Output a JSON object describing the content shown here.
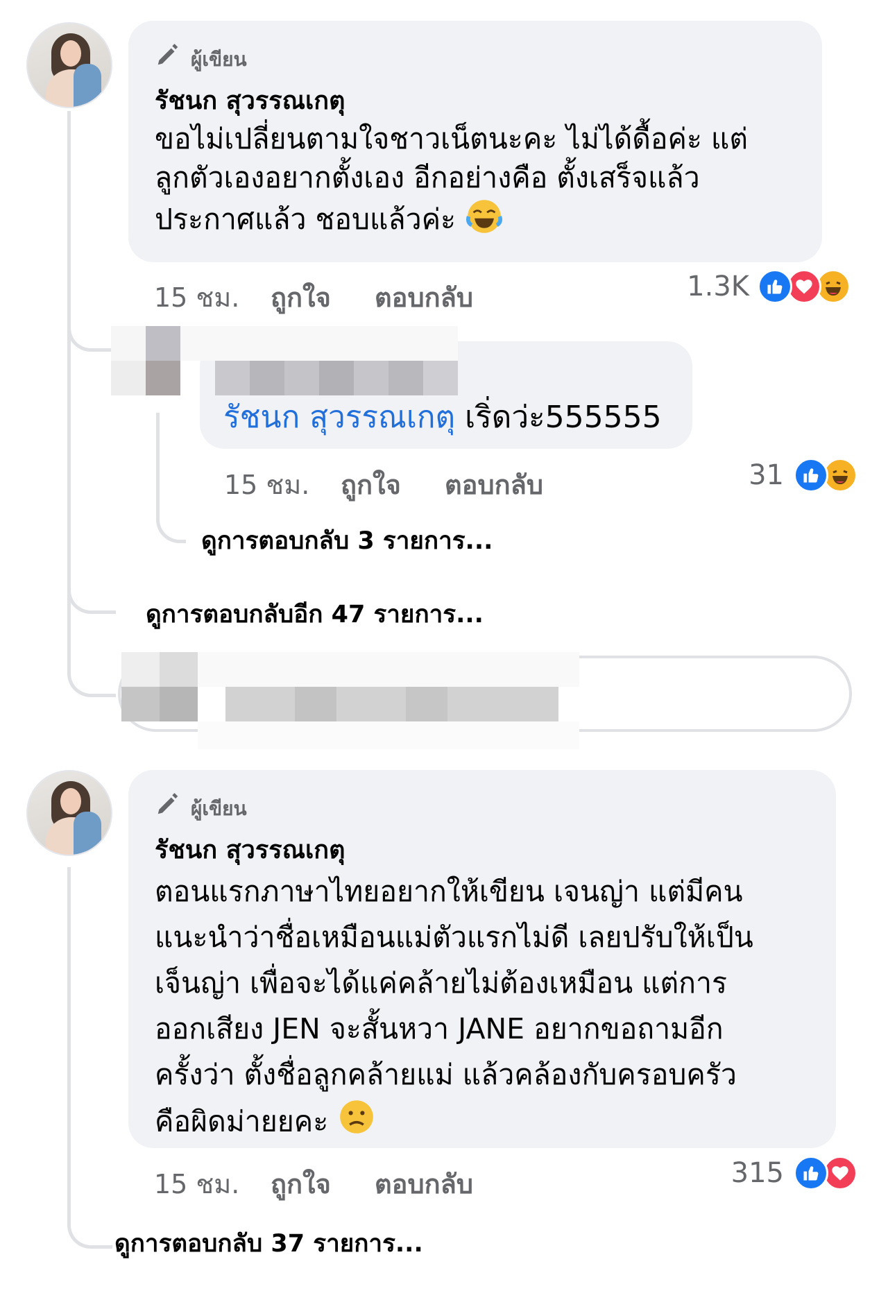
{
  "comments": [
    {
      "author_badge": "ผู้เขียน",
      "name": "รัชนก สุวรรณเกตุ",
      "text_lines": [
        "ขอไม่เปลี่ยนตามใจชาวเน็ตนะคะ ไม่ได้ดื้อค่ะ แต่",
        "ลูกตัวเองอยากตั้งเอง อีกอย่างคือ ตั้งเสร็จแล้ว",
        "ประกาศแล้ว ชอบแล้วค่ะ"
      ],
      "time": "15 ชม.",
      "like_label": "ถูกใจ",
      "reply_label": "ตอบกลับ",
      "reaction_count": "1.3K",
      "reactions": [
        "like-icon",
        "love-icon",
        "haha-icon"
      ],
      "end_emoji": "laughing-tears-emoji"
    },
    {
      "mention": "รัชนก สุวรรณเกตุ",
      "text": " เริ่ดว่ะ555555",
      "time": "15 ชม.",
      "like_label": "ถูกใจ",
      "reply_label": "ตอบกลับ",
      "reaction_count": "31",
      "reactions": [
        "like-icon",
        "haha-icon"
      ]
    },
    {
      "author_badge": "ผู้เขียน",
      "name": "รัชนก สุวรรณเกตุ",
      "text_lines": [
        "ตอนแรกภาษาไทยอยากให้เขียน เจนญ่า แต่มีคน",
        "แนะนำว่าชื่อเหมือนแม่ตัวแรกไม่ดี เลยปรับให้เป็น",
        "เจ็นญ่า เพื่อจะได้แค่คล้ายไม่ต้องเหมือน แต่การ",
        "ออกเสียง JEN จะสั้นหวา JANE อยากขอถามอีก",
        "ครั้งว่า ตั้งชื่อลูกคล้ายแม่ แล้วคล้องกับครอบครัว",
        "คือผิดม่ายยคะ"
      ],
      "time": "15 ชม.",
      "like_label": "ถูกใจ",
      "reply_label": "ตอบกลับ",
      "reaction_count": "315",
      "reactions": [
        "like-icon",
        "love-icon"
      ],
      "end_emoji": "confused-face-emoji"
    }
  ],
  "view_more": {
    "nested_replies": "ดูการตอบกลับ 3 รายการ...",
    "more_replies": "ดูการตอบกลับอีก 47 รายการ...",
    "bottom_replies": "ดูการตอบกลับ 37 รายการ..."
  },
  "colors": {
    "bubble": "#f0f2f5",
    "meta_text": "#65676b",
    "mention": "#216fdb",
    "like": "#1877f2",
    "love": "#f33e58",
    "haha": "#f7b125"
  }
}
